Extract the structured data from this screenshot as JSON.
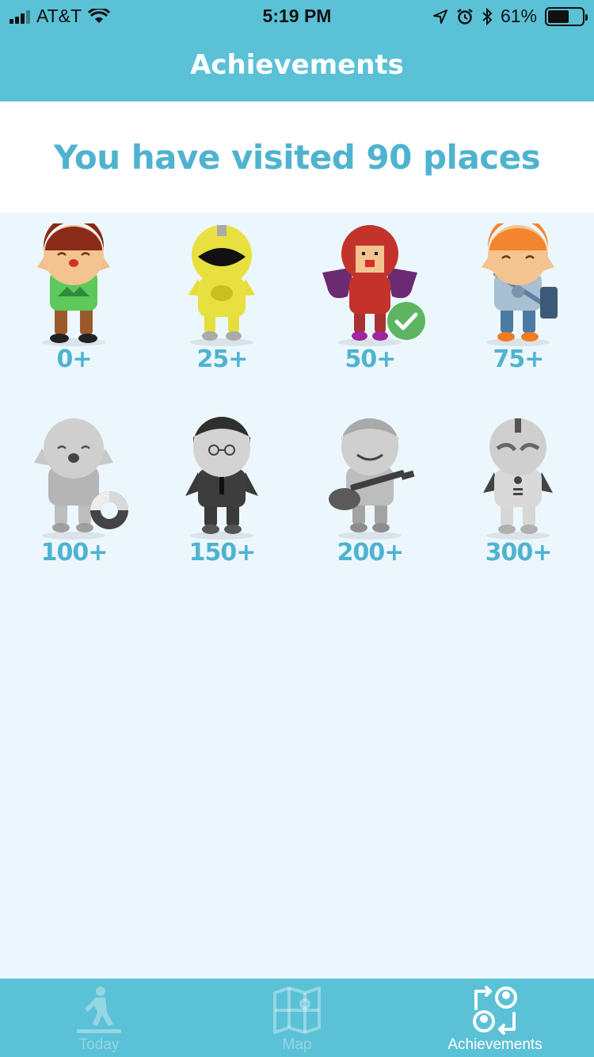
{
  "status_bar": {
    "carrier": "AT&T",
    "time": "5:19 PM",
    "battery_percent": "61%",
    "battery_level": 0.61,
    "icons": [
      "signal-icon",
      "wifi-icon",
      "location-arrow-icon",
      "alarm-icon",
      "bluetooth-icon",
      "battery-icon"
    ]
  },
  "nav": {
    "title": "Achievements"
  },
  "summary": {
    "text": "You have visited 90 places"
  },
  "badges": [
    {
      "label": "0+",
      "character": "kid",
      "unlocked": true,
      "achieved": false
    },
    {
      "label": "25+",
      "character": "ranger",
      "unlocked": true,
      "achieved": false
    },
    {
      "label": "50+",
      "character": "caped-hero",
      "unlocked": true,
      "achieved": true
    },
    {
      "label": "75+",
      "character": "mail-carrier",
      "unlocked": true,
      "achieved": false
    },
    {
      "label": "100+",
      "character": "swimmer",
      "unlocked": false,
      "achieved": false
    },
    {
      "label": "150+",
      "character": "businessman",
      "unlocked": false,
      "achieved": false
    },
    {
      "label": "200+",
      "character": "guitarist",
      "unlocked": false,
      "achieved": false
    },
    {
      "label": "300+",
      "character": "robot",
      "unlocked": false,
      "achieved": false
    }
  ],
  "tabs": [
    {
      "label": "Today",
      "icon": "walker-icon",
      "active": false
    },
    {
      "label": "Map",
      "icon": "map-icon",
      "active": false
    },
    {
      "label": "Achievements",
      "icon": "achievements-icon",
      "active": true
    }
  ],
  "colors": {
    "brand": "#5bc1d6",
    "accent_text": "#4fb3cf",
    "background": "#ecf7fd",
    "check": "#5db561"
  }
}
